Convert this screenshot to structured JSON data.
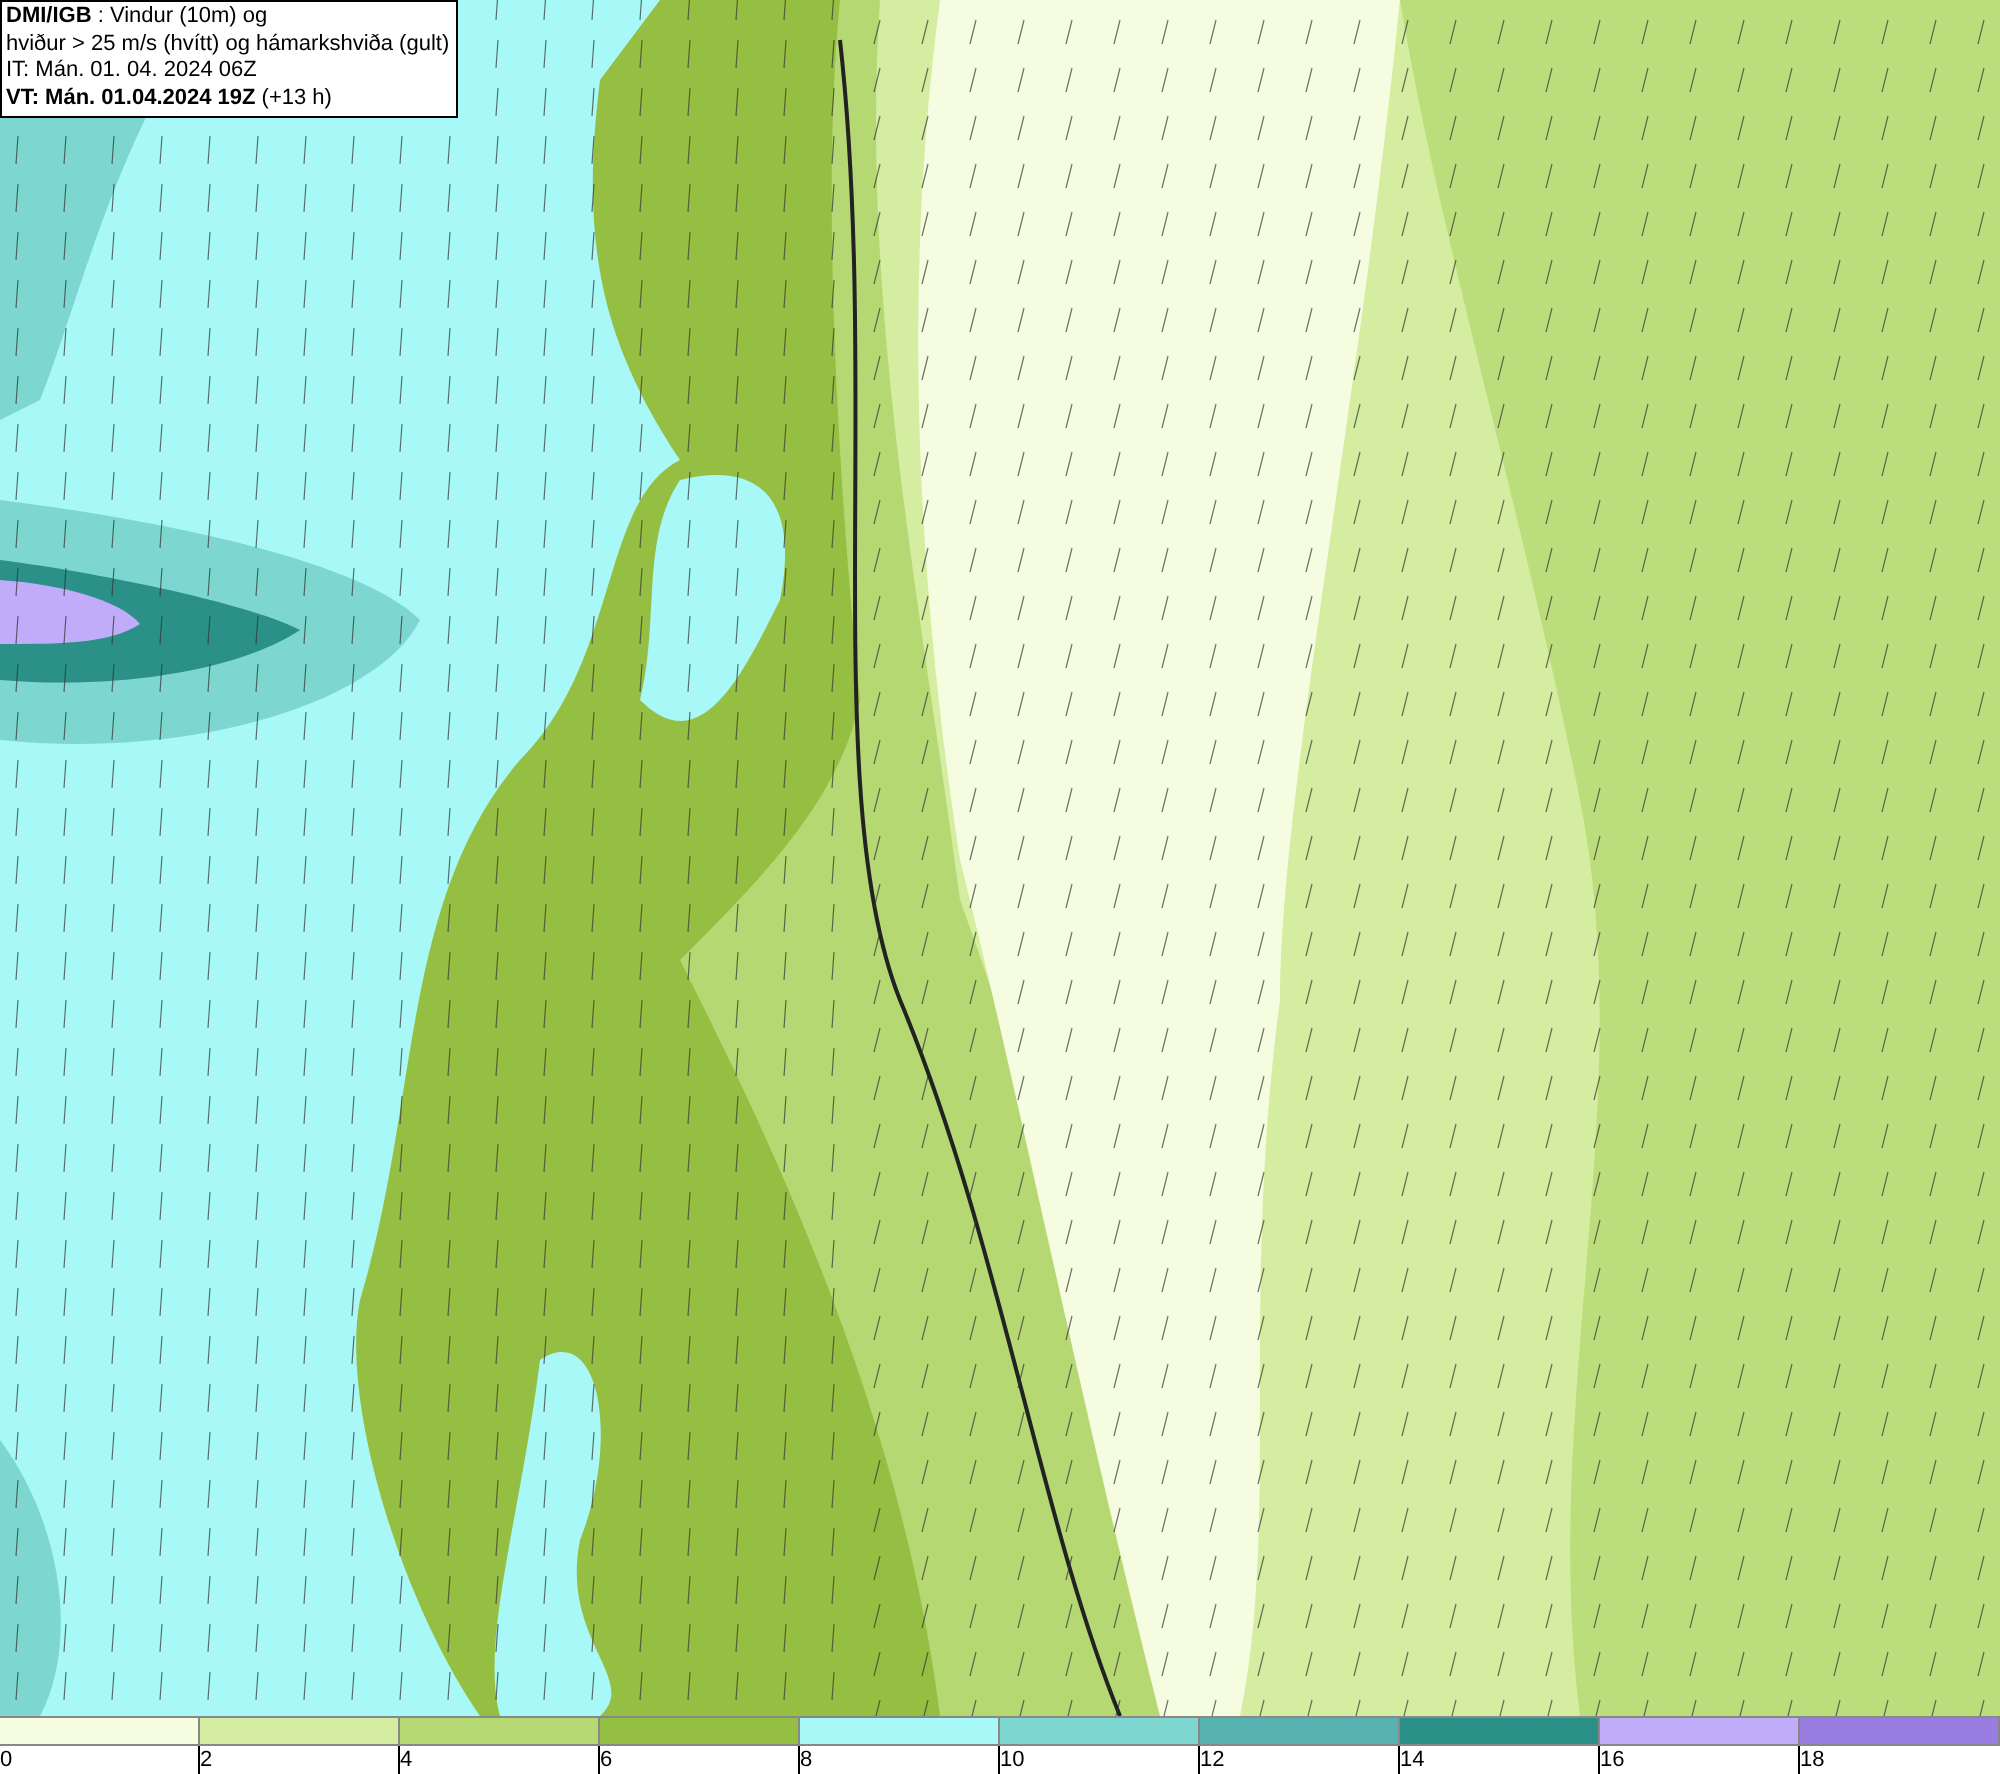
{
  "header": {
    "source": "DMI/IGB",
    "title": " : Vindur (10m) og",
    "subtitle": "hviður > 25 m/s (hvítt) og hámarkshviða (gult)",
    "init_time": "IT: Mán. 01. 04. 2024 06Z",
    "valid_time": "VT: Mán. 01.04.2024 19Z",
    "valid_offset": "(+13 h)"
  },
  "legend": {
    "swatches": [
      {
        "color": "#f5fce0"
      },
      {
        "color": "#d4eda0"
      },
      {
        "color": "#b5d873"
      },
      {
        "color": "#95bf42"
      },
      {
        "color": "#a8f8f8"
      },
      {
        "color": "#7dd6d0"
      },
      {
        "color": "#56b3b0"
      },
      {
        "color": "#2a9088"
      },
      {
        "color": "#c0acf8"
      },
      {
        "color": "#9a7de0"
      }
    ],
    "ticks": [
      "0",
      "2",
      "4",
      "6",
      "8",
      "10",
      "12",
      "14",
      "16",
      "18"
    ]
  }
}
